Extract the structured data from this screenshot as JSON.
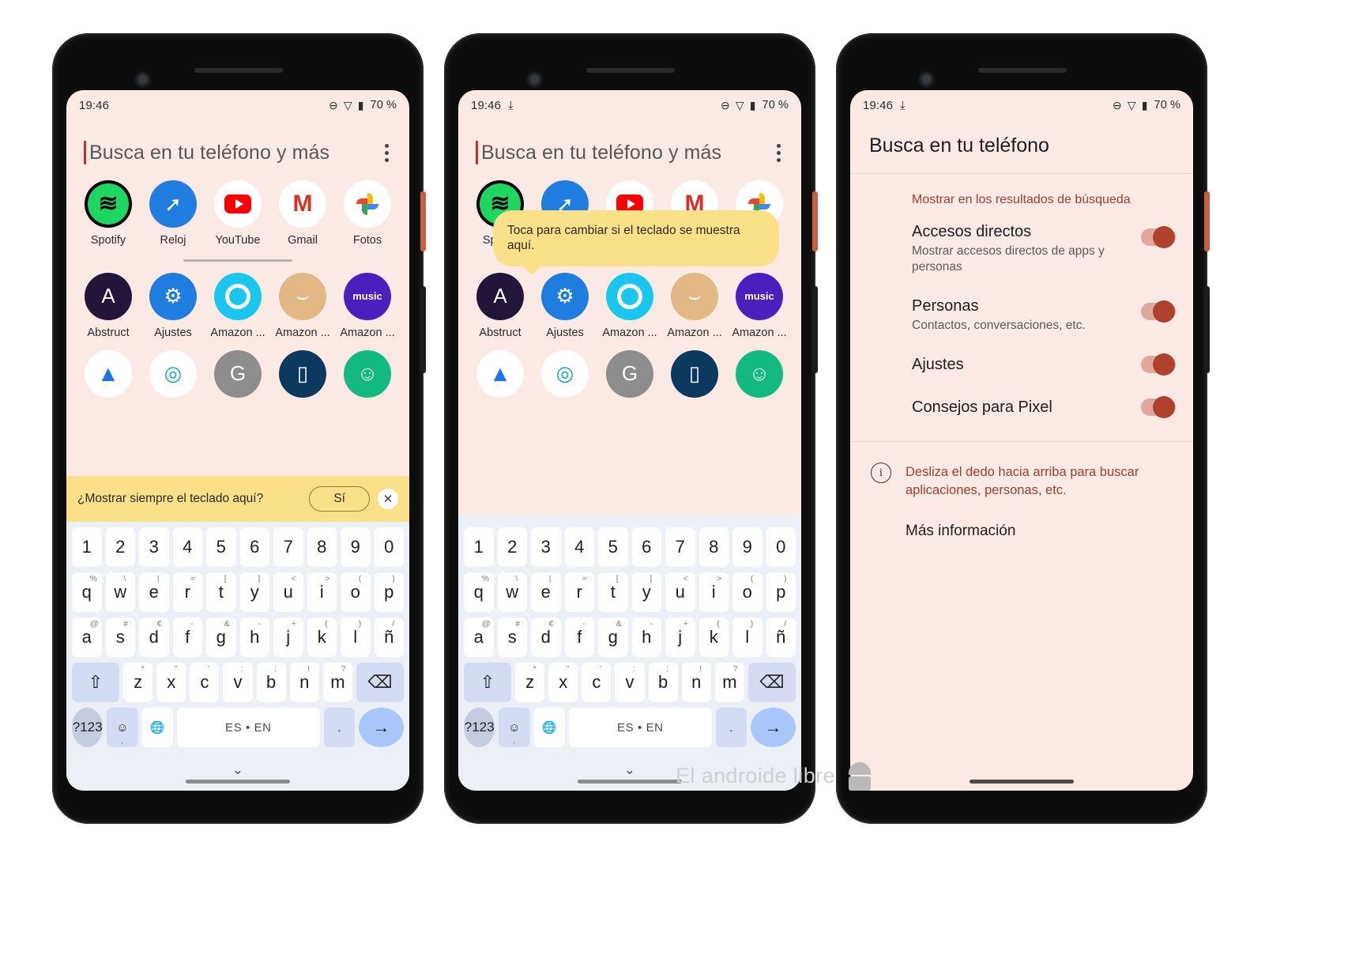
{
  "status_bar": {
    "time": "19:46",
    "download_icon": "download-icon",
    "dnd_icon": "do-not-disturb-icon",
    "wifi_icon": "wifi-icon",
    "battery_icon": "battery-icon",
    "battery_text": "70 %"
  },
  "search": {
    "placeholder": "Busca en tu teléfono y más",
    "overflow_icon": "overflow-menu-icon"
  },
  "apps": {
    "row1": [
      {
        "label": "Spotify",
        "icon": "spotify-icon"
      },
      {
        "label": "Reloj",
        "icon": "clock-icon"
      },
      {
        "label": "YouTube",
        "icon": "youtube-icon"
      },
      {
        "label": "Gmail",
        "icon": "gmail-icon"
      },
      {
        "label": "Fotos",
        "icon": "google-photos-icon"
      }
    ],
    "row2": [
      {
        "label": "Abstruct",
        "icon": "abstruct-icon"
      },
      {
        "label": "Ajustes",
        "icon": "settings-gear-icon"
      },
      {
        "label": "Amazon ...",
        "icon": "amazon-alexa-icon"
      },
      {
        "label": "Amazon ...",
        "icon": "amazon-shopping-icon"
      },
      {
        "label": "Amazon ...",
        "icon": "amazon-music-icon",
        "badge": "music"
      }
    ],
    "row3": [
      {
        "label": "",
        "icon": "android-auto-icon"
      },
      {
        "label": "",
        "icon": "camera-icon"
      },
      {
        "label": "",
        "icon": "gray-app-icon"
      },
      {
        "label": "",
        "icon": "navy-app-icon"
      },
      {
        "label": "",
        "icon": "green-messages-icon"
      }
    ]
  },
  "keyboard_banner": {
    "question": "¿Mostrar siempre el teclado aquí?",
    "yes_label": "Sí",
    "close_icon": "close-icon"
  },
  "tooltip": {
    "text": "Toca para cambiar si el teclado se muestra aquí."
  },
  "keyboard": {
    "number_row": [
      "1",
      "2",
      "3",
      "4",
      "5",
      "6",
      "7",
      "8",
      "9",
      "0"
    ],
    "row1": [
      {
        "k": "q",
        "sup": "%"
      },
      {
        "k": "w",
        "sup": "\\"
      },
      {
        "k": "e",
        "sup": "|"
      },
      {
        "k": "r",
        "sup": "="
      },
      {
        "k": "t",
        "sup": "["
      },
      {
        "k": "y",
        "sup": "]"
      },
      {
        "k": "u",
        "sup": "<"
      },
      {
        "k": "i",
        "sup": ">"
      },
      {
        "k": "o",
        "sup": "("
      },
      {
        "k": "p",
        "sup": ")"
      }
    ],
    "row2": [
      {
        "k": "a",
        "sup": "@"
      },
      {
        "k": "s",
        "sup": "#"
      },
      {
        "k": "d",
        "sup": "€"
      },
      {
        "k": "f",
        "sup": "-"
      },
      {
        "k": "g",
        "sup": "&"
      },
      {
        "k": "h",
        "sup": "-"
      },
      {
        "k": "j",
        "sup": "+"
      },
      {
        "k": "k",
        "sup": "("
      },
      {
        "k": "l",
        "sup": ")"
      },
      {
        "k": "ñ",
        "sup": "/"
      }
    ],
    "row3": [
      {
        "k": "z",
        "sup": "*"
      },
      {
        "k": "x",
        "sup": "\""
      },
      {
        "k": "c",
        "sup": "'"
      },
      {
        "k": "v",
        "sup": ":"
      },
      {
        "k": "b",
        "sup": ";"
      },
      {
        "k": "n",
        "sup": "!"
      },
      {
        "k": "m",
        "sup": "?"
      }
    ],
    "shift_icon": "shift-arrow-icon",
    "backspace_icon": "backspace-icon",
    "symbols_label": "?123",
    "emoji_icon": "emoji-icon",
    "emoji_sub": ",",
    "globe_icon": "language-globe-icon",
    "space_label": "ES • EN",
    "period_label": ".",
    "enter_icon": "enter-arrow-icon",
    "collapse_icon": "chevron-down-icon"
  },
  "settings": {
    "title": "Busca en tu teléfono",
    "section_header": "Mostrar en los resultados de búsqueda",
    "items": [
      {
        "title": "Accesos directos",
        "subtitle": "Mostrar accesos directos de apps y personas",
        "toggle": "on"
      },
      {
        "title": "Personas",
        "subtitle": "Contactos, conversaciones, etc.",
        "toggle": "on"
      },
      {
        "title": "Ajustes",
        "subtitle": "",
        "toggle": "on"
      },
      {
        "title": "Consejos para Pixel",
        "subtitle": "",
        "toggle": "on"
      }
    ],
    "info_icon": "info-icon",
    "info_text": "Desliza el dedo hacia arriba para buscar aplicaciones, personas, etc.",
    "more_link": "Más información"
  },
  "watermark": {
    "text": "El androide libre",
    "icon": "android-robot-icon"
  },
  "colors": {
    "screen_bg": "#fbe9e4",
    "accent_red": "#a4402c",
    "banner_yellow": "#fbe08a",
    "key_blue": "#a8c7fa"
  }
}
